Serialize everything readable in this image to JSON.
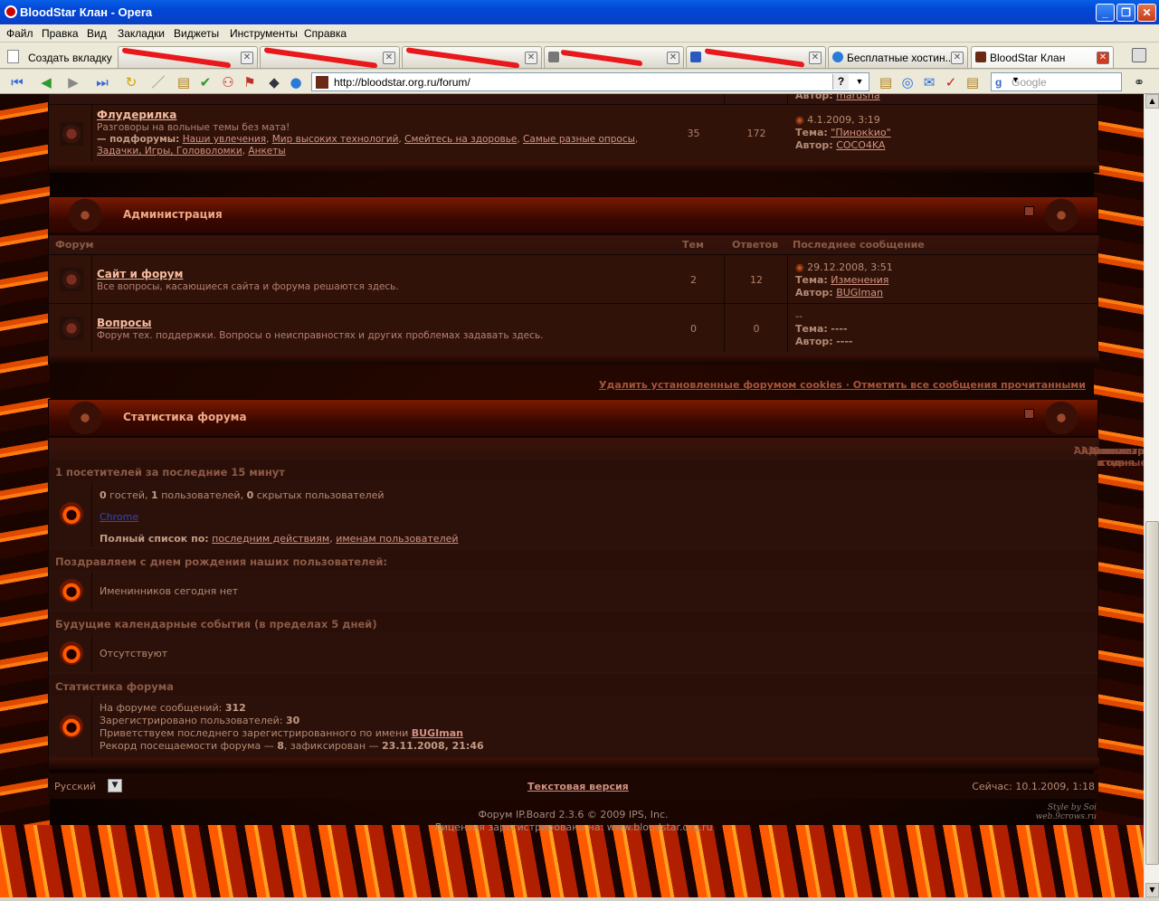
{
  "window": {
    "title": "BloodStar Клан - Opera"
  },
  "menu": [
    "Файл",
    "Правка",
    "Вид",
    "Закладки",
    "Виджеты",
    "Инструменты",
    "Справка"
  ],
  "tabs": {
    "new_tab": "Создать вкладку",
    "items": [
      {
        "label": "",
        "redacted": true
      },
      {
        "label": "",
        "redacted": true
      },
      {
        "label": "",
        "redacted": true
      },
      {
        "label": "",
        "redacted": true
      },
      {
        "label": "",
        "redacted": true
      },
      {
        "label": "Бесплатные хостин...",
        "redacted": false
      },
      {
        "label": "BloodStar Клан",
        "redacted": false,
        "active": true
      }
    ]
  },
  "address": {
    "url": "http://bloodstar.org.ru/forum/",
    "help": "?",
    "search_placeholder": "Google"
  },
  "forum": {
    "fluderilka": {
      "prev_author_label": "Автор:",
      "prev_author": "marusha",
      "title": "Флудерилка",
      "desc": "Разговоры на вольные темы без мата!",
      "sub_label": "— подфорумы:",
      "subforums": [
        "Наши увлечения",
        "Мир высоких технологий",
        "Смейтесь на здоровье",
        "Самые разные опросы",
        "Задачки, Игры, Головоломки",
        "Анкеты"
      ],
      "topics": "35",
      "replies": "172",
      "last_date": "4.1.2009, 3:19",
      "last_topic_label": "Тема:",
      "last_topic": "\"Пинокkио\"",
      "last_author_label": "Автор:",
      "last_author": "COCO4KA"
    },
    "admin": {
      "title": "Администрация",
      "cols": {
        "forum": "Форум",
        "topics": "Тем",
        "replies": "Ответов",
        "last": "Последнее сообщение"
      },
      "rows": [
        {
          "title": "Сайт и форум",
          "desc": "Все вопросы, касающиеся сайта и форума решаются здесь.",
          "topics": "2",
          "replies": "12",
          "date": "29.12.2008, 3:51",
          "topic_label": "Тема:",
          "topic": "Изменения",
          "author_label": "Автор:",
          "author": "BUGIman"
        },
        {
          "title": "Вопросы",
          "desc": "Форум тех. поддержки. Вопросы о неисправностях и других проблемах задавать здесь.",
          "topics": "0",
          "replies": "0",
          "date": "--",
          "topic_label": "Тема:",
          "topic": "----",
          "author_label": "Автор:",
          "author": "----"
        }
      ]
    },
    "links": {
      "delete_cookies": "Удалить установленные форумом cookies",
      "mark_read": "Отметить все сообщения прочитанными",
      "sep": "·"
    },
    "stats": {
      "title": "Статистика форума",
      "tabs": [
        "Активные темы",
        "Администрация",
        "Активные сегодня",
        "Самые активные"
      ],
      "online_header": "1 посетителей за последние 15 минут",
      "guests": "0",
      "guests_label": "гостей,",
      "users": "1",
      "users_label": "пользователей,",
      "hidden": "0",
      "hidden_label": "скрытых пользователей",
      "online_user": "Chrome",
      "full_list_label": "Полный список по:",
      "full_list_by_action": "последним действиям",
      "full_list_by_name": "именам пользователей",
      "birthday_header": "Поздравляем с днем рождения наших пользователей:",
      "birthday_text": "Именинников сегодня нет",
      "calendar_header": "Будущие календарные события (в пределах 5 дней)",
      "calendar_text": "Отсутствуют",
      "board_header": "Статистика форума",
      "posts_label": "На форуме сообщений:",
      "posts": "312",
      "members_label": "Зарегистрировано пользователей:",
      "members": "30",
      "newest_label": "Приветствуем последнего зарегистрированного по имени",
      "newest": "BUGIman",
      "record_label": "Рекорд посещаемости форума —",
      "record_count": "8",
      "record_mid": ", зафиксирован —",
      "record_date": "23.11.2008, 21:46"
    },
    "footer": {
      "lang": "Русский",
      "text_version": "Текстовая версия",
      "now": "Сейчас: 10.1.2009, 1:18",
      "copyright": "Форум IP.Board 2.3.6 © 2009  IPS, Inc.",
      "license": "Лицензия зарегистрирована на: www.bloodstar.org.ru",
      "style": "Style by Soi",
      "style_site": "web.9crows.ru"
    }
  }
}
